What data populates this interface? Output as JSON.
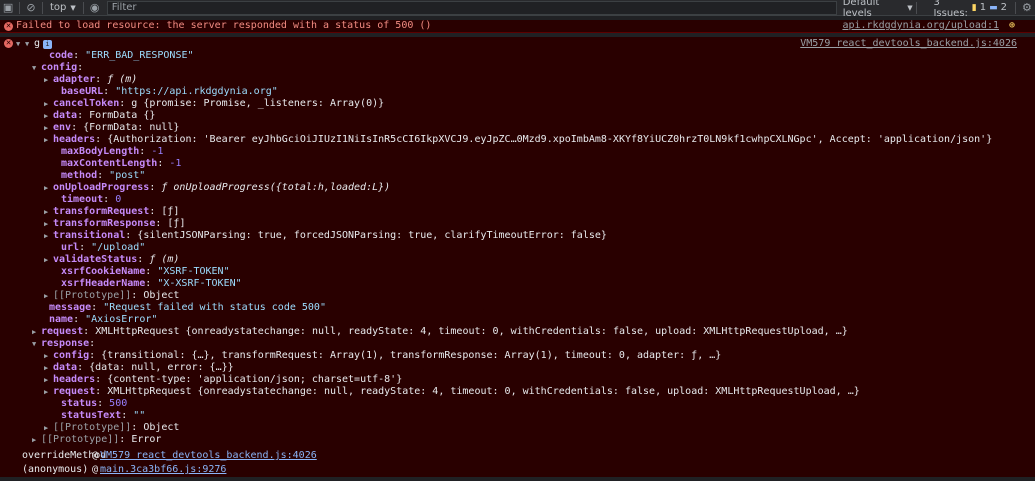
{
  "toolbar": {
    "context": "top",
    "filter_placeholder": "Filter",
    "levels": "Default levels",
    "issues_label": "3 Issues:",
    "warn_count": "1",
    "info_count": "2"
  },
  "error1": {
    "message": "Failed to load resource: the server responded with a status of 500 ()",
    "source": "api.rkdgdynia.org/upload:1"
  },
  "error2": {
    "object_name": "g",
    "source": "VM579 react_devtools_backend.js:4026"
  },
  "lines": [
    {
      "indent": 40,
      "tri": "",
      "key": "code",
      "val": "\"ERR_BAD_RESPONSE\"",
      "cls": "str2"
    },
    {
      "indent": 32,
      "tri": "▼",
      "key": "config",
      "val": "",
      "cls": "plain"
    },
    {
      "indent": 44,
      "tri": "▶",
      "key": "adapter",
      "val": "ƒ (m)",
      "cls": "ital"
    },
    {
      "indent": 52,
      "tri": "",
      "key": "baseURL",
      "val": "\"https://api.rkdgdynia.org\"",
      "cls": "str2"
    },
    {
      "indent": 44,
      "tri": "▶",
      "key": "cancelToken",
      "val": "g {promise: Promise, _listeners: Array(0)}",
      "cls": "plain"
    },
    {
      "indent": 44,
      "tri": "▶",
      "key": "data",
      "val": "FormData {}",
      "cls": "plain"
    },
    {
      "indent": 44,
      "tri": "▶",
      "key": "env",
      "val": "{FormData: null}",
      "cls": "plain"
    },
    {
      "indent": 44,
      "tri": "▶",
      "key": "headers",
      "val": "{Authorization: 'Bearer eyJhbGciOiJIUzI1NiIsInR5cCI6IkpXVCJ9.eyJpZC…0Mzd9.xpoImbAm8-XKYf8YiUCZ0hrzT0LN9kf1cwhpCXLNGpc', Accept: 'application/json'}",
      "cls": "plain"
    },
    {
      "indent": 52,
      "tri": "",
      "key": "maxBodyLength",
      "val": "-1",
      "cls": "num"
    },
    {
      "indent": 52,
      "tri": "",
      "key": "maxContentLength",
      "val": "-1",
      "cls": "num"
    },
    {
      "indent": 52,
      "tri": "",
      "key": "method",
      "val": "\"post\"",
      "cls": "str2"
    },
    {
      "indent": 44,
      "tri": "▶",
      "key": "onUploadProgress",
      "val": "ƒ onUploadProgress({total:h,loaded:L})",
      "cls": "ital"
    },
    {
      "indent": 52,
      "tri": "",
      "key": "timeout",
      "val": "0",
      "cls": "num"
    },
    {
      "indent": 44,
      "tri": "▶",
      "key": "transformRequest",
      "val": "[ƒ]",
      "cls": "plain"
    },
    {
      "indent": 44,
      "tri": "▶",
      "key": "transformResponse",
      "val": "[ƒ]",
      "cls": "plain"
    },
    {
      "indent": 44,
      "tri": "▶",
      "key": "transitional",
      "val": "{silentJSONParsing: true, forcedJSONParsing: true, clarifyTimeoutError: false}",
      "cls": "plain"
    },
    {
      "indent": 52,
      "tri": "",
      "key": "url",
      "val": "\"/upload\"",
      "cls": "str2"
    },
    {
      "indent": 44,
      "tri": "▶",
      "key": "validateStatus",
      "val": "ƒ (m)",
      "cls": "ital"
    },
    {
      "indent": 52,
      "tri": "",
      "key": "xsrfCookieName",
      "val": "\"XSRF-TOKEN\"",
      "cls": "str2"
    },
    {
      "indent": 52,
      "tri": "",
      "key": "xsrfHeaderName",
      "val": "\"X-XSRF-TOKEN\"",
      "cls": "str2"
    },
    {
      "indent": 44,
      "tri": "▶",
      "key": "[[Prototype]]",
      "val": "Object",
      "cls": "plain",
      "proto": true
    },
    {
      "indent": 40,
      "tri": "",
      "key": "message",
      "val": "\"Request failed with status code 500\"",
      "cls": "str2"
    },
    {
      "indent": 40,
      "tri": "",
      "key": "name",
      "val": "\"AxiosError\"",
      "cls": "str2"
    },
    {
      "indent": 32,
      "tri": "▶",
      "key": "request",
      "val": "XMLHttpRequest {onreadystatechange: null, readyState: 4, timeout: 0, withCredentials: false, upload: XMLHttpRequestUpload, …}",
      "cls": "plain"
    },
    {
      "indent": 32,
      "tri": "▼",
      "key": "response",
      "val": "",
      "cls": "plain"
    },
    {
      "indent": 44,
      "tri": "▶",
      "key": "config",
      "val": "{transitional: {…}, transformRequest: Array(1), transformResponse: Array(1), timeout: 0, adapter: ƒ, …}",
      "cls": "plain"
    },
    {
      "indent": 44,
      "tri": "▶",
      "key": "data",
      "val": "{data: null, error: {…}}",
      "cls": "plain"
    },
    {
      "indent": 44,
      "tri": "▶",
      "key": "headers",
      "val": "{content-type: 'application/json; charset=utf-8'}",
      "cls": "plain"
    },
    {
      "indent": 44,
      "tri": "▶",
      "key": "request",
      "val": "XMLHttpRequest {onreadystatechange: null, readyState: 4, timeout: 0, withCredentials: false, upload: XMLHttpRequestUpload, …}",
      "cls": "plain"
    },
    {
      "indent": 52,
      "tri": "",
      "key": "status",
      "val": "500",
      "cls": "num"
    },
    {
      "indent": 52,
      "tri": "",
      "key": "statusText",
      "val": "\"\"",
      "cls": "str2"
    },
    {
      "indent": 44,
      "tri": "▶",
      "key": "[[Prototype]]",
      "val": "Object",
      "cls": "plain",
      "proto": true
    },
    {
      "indent": 32,
      "tri": "▶",
      "key": "[[Prototype]]",
      "val": "Error",
      "cls": "plain",
      "proto": true
    }
  ],
  "stack": [
    {
      "fn": "overrideMethod",
      "at": "@",
      "link": "VM579 react_devtools_backend.js:4026"
    },
    {
      "fn": "(anonymous)",
      "at": "@",
      "link": "main.3ca3bf66.js:9276"
    }
  ]
}
